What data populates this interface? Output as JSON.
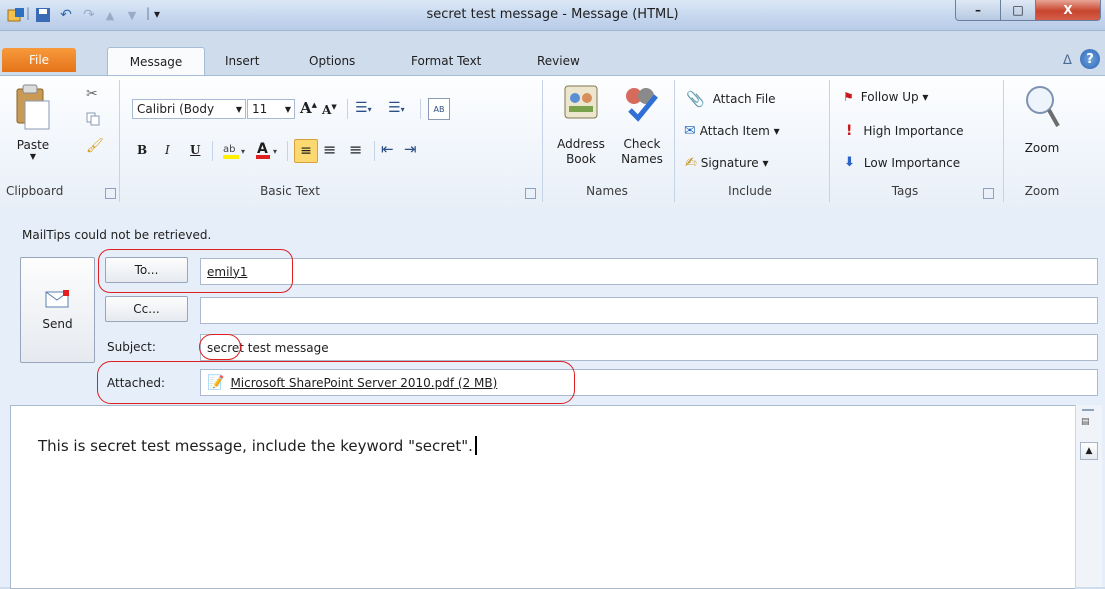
{
  "window": {
    "title": "secret test message  -  Message (HTML)",
    "controls": {
      "minimize": "–",
      "maximize": "□",
      "close": "X"
    }
  },
  "qat": {
    "separator": "|",
    "dropdown": "▾"
  },
  "tabs": {
    "file": "File",
    "items": [
      "Message",
      "Insert",
      "Options",
      "Format Text",
      "Review"
    ],
    "active": "Message"
  },
  "ribbon": {
    "clipboard": {
      "paste": "Paste",
      "group": "Clipboard"
    },
    "basic_text": {
      "font": "Calibri (Bodу",
      "size": "11",
      "bold": "B",
      "italic": "I",
      "underline": "U",
      "group": "Basic Text"
    },
    "names": {
      "address_book_1": "Address",
      "address_book_2": "Book",
      "check_names_1": "Check",
      "check_names_2": "Names",
      "group": "Names"
    },
    "include": {
      "attach_file": "Attach File",
      "attach_item": "Attach Item ▾",
      "signature": "Signature ▾",
      "group": "Include"
    },
    "tags": {
      "follow_up": "Follow Up ▾",
      "high_importance": "High Importance",
      "low_importance": "Low Importance",
      "group": "Tags"
    },
    "zoom": {
      "zoom": "Zoom",
      "group": "Zoom"
    }
  },
  "mail": {
    "mailtips": "MailTips could not be retrieved.",
    "send": "Send",
    "to_button": "To...",
    "to_value": "emily1",
    "cc_button": "Cc...",
    "cc_value": "",
    "subject_label": "Subject:",
    "subject_value": "secret test message",
    "attached_label": "Attached:",
    "attachment": "Microsoft SharePoint Server 2010.pdf (2 MB)",
    "body": "This is secret test message, include the keyword \"secret\"."
  },
  "colors": {
    "file_tab": "#e5731a",
    "annotation": "#e02020",
    "ribbon_border": "#a6bbd6"
  }
}
